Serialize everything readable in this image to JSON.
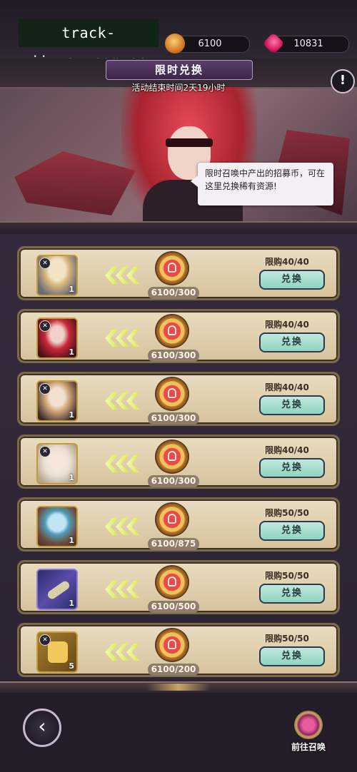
{
  "watermark": "track-jiuyou.com.cn",
  "resources": {
    "coin": "6100",
    "gem": "10831"
  },
  "banner": {
    "title": "限时兑换",
    "end_time": "活动结束时间2天19小时",
    "tip": "限时召唤中产出的招募币，可在这里兑换稀有资源!",
    "info_label": "!"
  },
  "exchange_items": [
    {
      "count": "1",
      "progress": "6100/300",
      "limit": "限购40/40",
      "button": "兑换"
    },
    {
      "count": "1",
      "progress": "6100/300",
      "limit": "限购40/40",
      "button": "兑换"
    },
    {
      "count": "1",
      "progress": "6100/300",
      "limit": "限购40/40",
      "button": "兑换"
    },
    {
      "count": "1",
      "progress": "6100/300",
      "limit": "限购40/40",
      "button": "兑换"
    },
    {
      "count": "1",
      "progress": "6100/875",
      "limit": "限购50/50",
      "button": "兑换"
    },
    {
      "count": "1",
      "progress": "6100/500",
      "limit": "限购50/50",
      "button": "兑换"
    },
    {
      "count": "5",
      "progress": "6100/200",
      "limit": "限购50/50",
      "button": "兑换"
    }
  ],
  "footer": {
    "back": "‹",
    "summon_label": "前往召唤"
  },
  "icons": {
    "coin": "summon-coin-icon",
    "gem": "gem-icon",
    "arrow": "chevron-left-icon",
    "token": "recruit-token-icon"
  }
}
